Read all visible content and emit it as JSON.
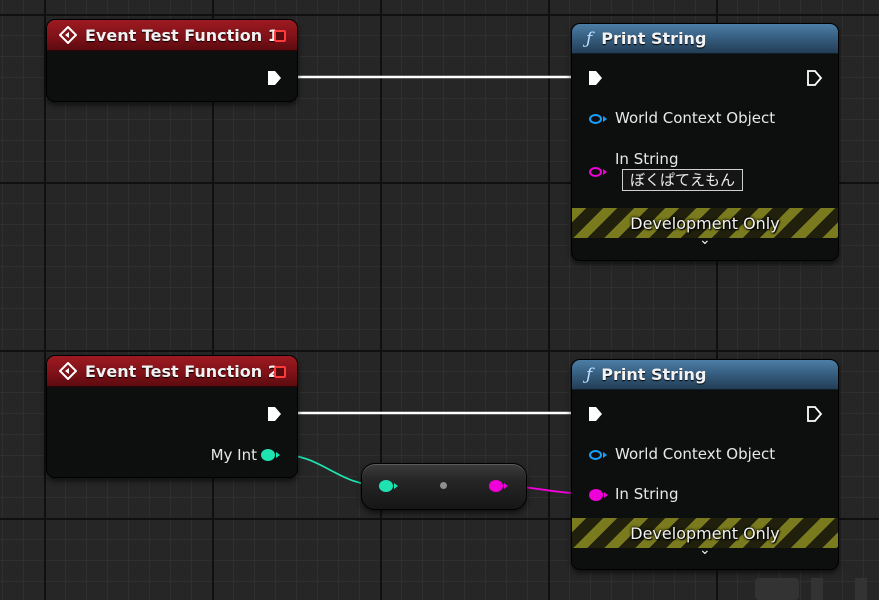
{
  "colors": {
    "exec_pin": "#ffffff",
    "object_pin": "#1aa0ff",
    "string_pin": "#f000d8",
    "int_pin": "#1ee3b0",
    "event_header": "#7c1117",
    "function_header": "#33597a"
  },
  "icons": {
    "event": "event-diamond-icon",
    "function": "function-f-icon",
    "stop": "stop-square-icon",
    "expand": "chevron-down-icon"
  },
  "events": [
    {
      "title": "Event Test Function 1"
    },
    {
      "title": "Event Test Function 2",
      "output_label": "My Int"
    }
  ],
  "print_nodes": [
    {
      "title": "Print String",
      "func_symbol": "ƒ",
      "world_context_label": "World Context Object",
      "in_string_label": "In String",
      "in_string_value": "ぼくぱてえもん",
      "dev_only_label": "Development Only",
      "chevron": "⌄"
    },
    {
      "title": "Print String",
      "func_symbol": "ƒ",
      "world_context_label": "World Context Object",
      "in_string_label": "In String",
      "dev_only_label": "Development Only",
      "chevron": "⌄"
    }
  ]
}
